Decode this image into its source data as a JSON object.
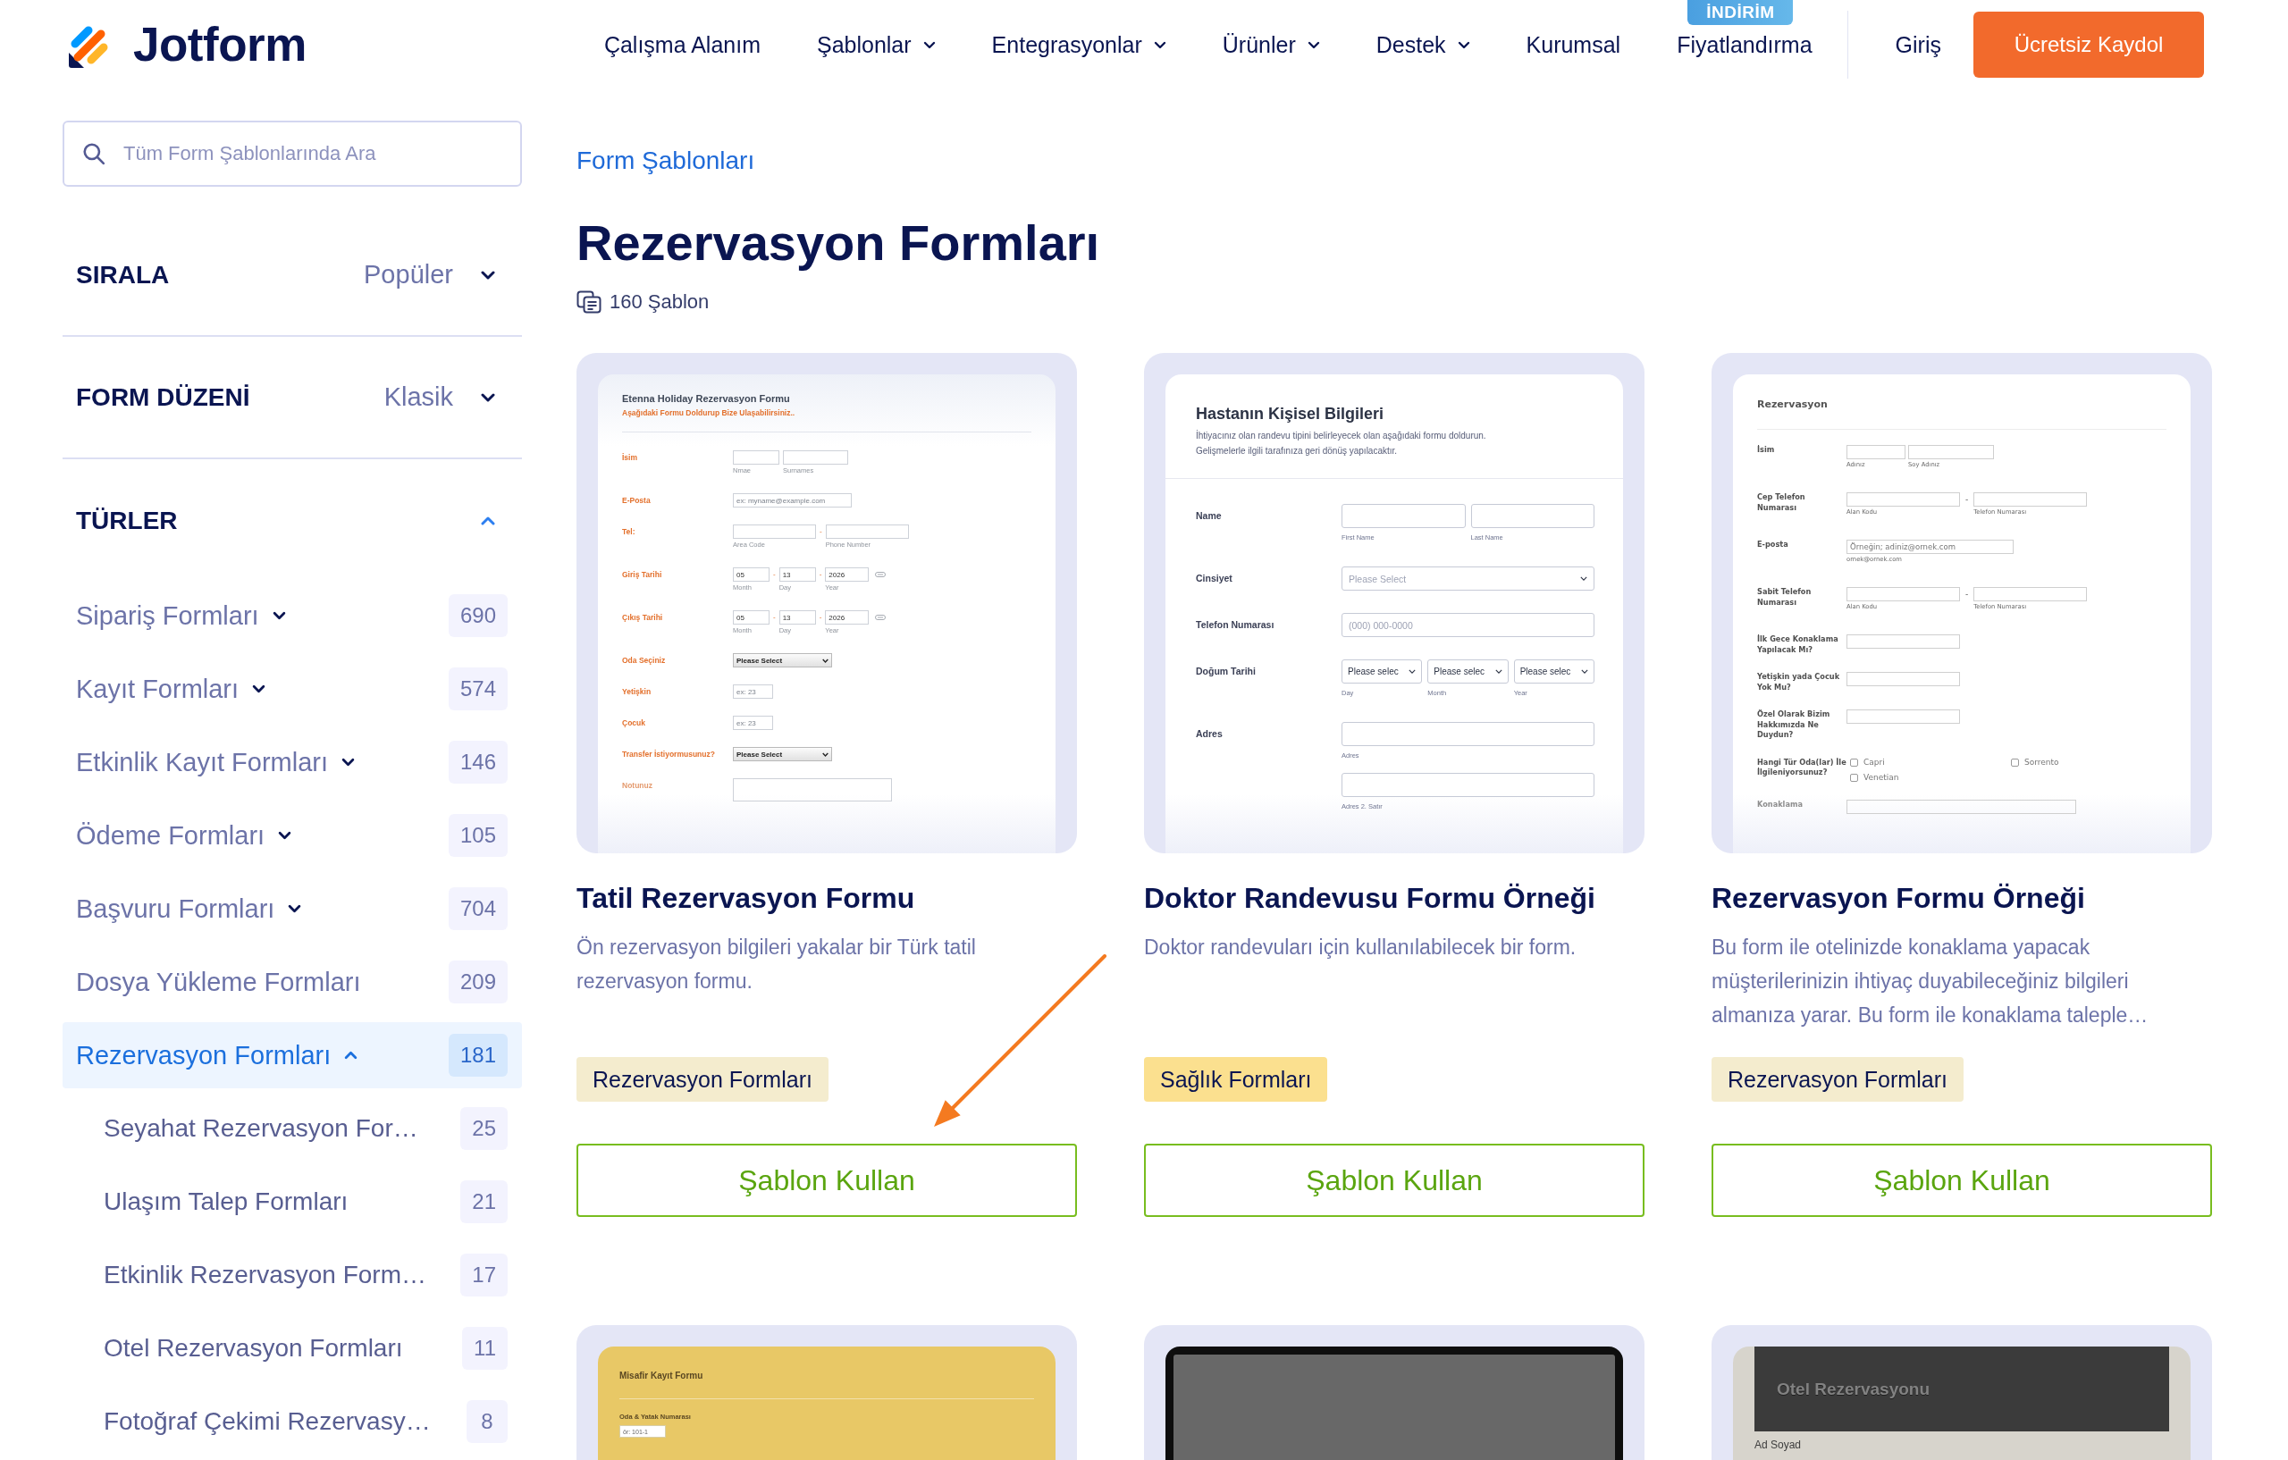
{
  "header": {
    "logo": "Jotform",
    "nav": [
      {
        "label": "Çalışma Alanım",
        "dropdown": false
      },
      {
        "label": "Şablonlar",
        "dropdown": true
      },
      {
        "label": "Entegrasyonlar",
        "dropdown": true
      },
      {
        "label": "Ürünler",
        "dropdown": true
      },
      {
        "label": "Destek",
        "dropdown": true
      },
      {
        "label": "Kurumsal",
        "dropdown": false
      },
      {
        "label": "Fiyatlandırma",
        "dropdown": false,
        "badge": "İNDİRİM"
      }
    ],
    "login": "Giriş",
    "signup": "Ücretsiz Kaydol"
  },
  "sidebar": {
    "search": {
      "placeholder": "Tüm Form Şablonlarında Ara"
    },
    "filters": [
      {
        "label": "SIRALA",
        "value": "Popüler"
      },
      {
        "label": "FORM DÜZENİ",
        "value": "Klasik"
      }
    ],
    "types": {
      "label": "TÜRLER",
      "expanded": true,
      "items": [
        {
          "label": "Sipariş Formları",
          "count": "690",
          "expandable": true,
          "expanded": false,
          "selected": false
        },
        {
          "label": "Kayıt Formları",
          "count": "574",
          "expandable": true,
          "expanded": false,
          "selected": false
        },
        {
          "label": "Etkinlik Kayıt Formları",
          "count": "146",
          "expandable": true,
          "expanded": false,
          "selected": false
        },
        {
          "label": "Ödeme Formları",
          "count": "105",
          "expandable": true,
          "expanded": false,
          "selected": false
        },
        {
          "label": "Başvuru Formları",
          "count": "704",
          "expandable": true,
          "expanded": false,
          "selected": false
        },
        {
          "label": "Dosya Yükleme Formları",
          "count": "209",
          "expandable": false,
          "expanded": false,
          "selected": false
        },
        {
          "label": "Rezervasyon Formları",
          "count": "181",
          "expandable": true,
          "expanded": true,
          "selected": true,
          "children": [
            {
              "label": "Seyahat Rezervasyon For…",
              "count": "25",
              "selected": false
            },
            {
              "label": "Ulaşım Talep Formları",
              "count": "21",
              "selected": false
            },
            {
              "label": "Etkinlik Rezervasyon Form…",
              "count": "17",
              "selected": false
            },
            {
              "label": "Otel Rezervasyon Formları",
              "count": "11",
              "selected": false
            },
            {
              "label": "Fotoğraf Çekimi Rezervasy…",
              "count": "8",
              "selected": false
            }
          ]
        }
      ]
    }
  },
  "main": {
    "breadcrumb": "Form Şablonları",
    "title": "Rezervasyon Formları",
    "count": "160 Şablon",
    "cards": [
      {
        "title": "Tatil Rezervasyon Formu",
        "description": "Ön rezervasyon bilgileri yakalar bir Türk tatil rezervasyon formu.",
        "tag": {
          "label": "Rezervasyon Formları",
          "color": "#f4ecce"
        },
        "button": "Şablon Kullan",
        "preview": {
          "kind": "classic",
          "title": "Etenna Holiday Rezervasyon Formu",
          "subtitle": "Aşağıdaki Formu Doldurup Bize Ulaşabilirsiniz..",
          "fields": [
            {
              "label": "İsim",
              "kind": "name",
              "inputs": [
                {
                  "sublabel": "Nmae"
                },
                {
                  "sublabel": "Surnames"
                }
              ]
            },
            {
              "label": "E-Posta",
              "kind": "email",
              "inputs": [
                {
                  "placeholder": "ex: myname@example.com"
                }
              ]
            },
            {
              "label": "Tel:",
              "kind": "phone",
              "joiner": "-",
              "inputs": [
                {
                  "sublabel": "Area Code"
                },
                {
                  "sublabel": "Phone Number"
                }
              ]
            },
            {
              "label": "Giriş Tarihi",
              "kind": "date",
              "joiner": "-",
              "calendar": true,
              "inputs": [
                {
                  "value": "05",
                  "sublabel": "Month"
                },
                {
                  "value": "13",
                  "sublabel": "Day"
                },
                {
                  "value": "2026",
                  "sublabel": "Year"
                }
              ]
            },
            {
              "label": "Çıkış Tarihi",
              "kind": "date",
              "joiner": "-",
              "calendar": true,
              "inputs": [
                {
                  "value": "05",
                  "sublabel": "Month"
                },
                {
                  "value": "13",
                  "sublabel": "Day"
                },
                {
                  "value": "2026",
                  "sublabel": "Year"
                }
              ]
            },
            {
              "label": "Oda Seçiniz",
              "kind": "select",
              "inputs": [
                {
                  "value": "Please Select"
                }
              ]
            },
            {
              "label": "Yetişkin",
              "kind": "number",
              "inputs": [
                {
                  "placeholder": "ex: 23"
                }
              ]
            },
            {
              "label": "Çocuk",
              "kind": "number",
              "inputs": [
                {
                  "placeholder": "ex: 23"
                }
              ]
            },
            {
              "label": "Transfer İstiyormusunuz?",
              "kind": "select",
              "inputs": [
                {
                  "value": "Please Select"
                }
              ]
            },
            {
              "label": "Notunuz",
              "kind": "textarea"
            }
          ]
        }
      },
      {
        "title": "Doktor Randevusu Formu Örneği",
        "description": "Doktor randevuları için kullanılabilecek bir form.",
        "tag": {
          "label": "Sağlık Formları",
          "color": "#fbe08f"
        },
        "button": "Şablon Kullan",
        "preview": {
          "kind": "modern",
          "title": "Hastanın Kişisel Bilgileri",
          "subtitle": "İhtiyacınız olan randevu tipini belirleyecek olan aşağıdaki formu doldurun. Gelişmelerle ilgili tarafınıza geri dönüş yapılacaktır.",
          "fields": [
            {
              "label": "Name",
              "kind": "name",
              "inputs": [
                {
                  "sublabel": "First Name"
                },
                {
                  "sublabel": "Last Name"
                }
              ]
            },
            {
              "label": "Cinsiyet",
              "kind": "select",
              "inputs": [
                {
                  "placeholder": "Please Select"
                }
              ]
            },
            {
              "label": "Telefon Numarası",
              "kind": "text",
              "inputs": [
                {
                  "placeholder": "(000) 000-0000"
                }
              ]
            },
            {
              "label": "Doğum Tarihi",
              "kind": "selects",
              "inputs": [
                {
                  "value": "Please selec",
                  "sublabel": "Day"
                },
                {
                  "value": "Please selec",
                  "sublabel": "Month"
                },
                {
                  "value": "Please selec",
                  "sublabel": "Year"
                }
              ]
            },
            {
              "label": "Adres",
              "kind": "address",
              "inputs": [
                {
                  "sublabel": "Adres"
                },
                {
                  "sublabel": "Adres 2. Satır"
                }
              ]
            }
          ]
        }
      },
      {
        "title": "Rezervasyon Formu Örneği",
        "description": "Bu form ile otelinizde konaklama yapacak müşterilerinizin ihtiyaç duyabileceğiniz bilgileri almanıza yarar. Bu form ile konaklama taleple…",
        "tag": {
          "label": "Rezervasyon Formları",
          "color": "#f4ecce"
        },
        "button": "Şablon Kullan",
        "preview": {
          "kind": "compact",
          "title": "Rezervasyon",
          "fields": [
            {
              "label": "İsim",
              "kind": "name",
              "inputs": [
                {
                  "sublabel": "Adınız"
                },
                {
                  "sublabel": "Soy Adınız"
                }
              ]
            },
            {
              "label": "Cep Telefon Numarası",
              "kind": "phone",
              "joiner": "-",
              "inputs": [
                {
                  "sublabel": "Alan Kodu"
                },
                {
                  "sublabel": "Telefon Numarası"
                }
              ]
            },
            {
              "label": "E-posta",
              "kind": "email",
              "inputs": [
                {
                  "placeholder": "Örneğin; adiniz@ornek.com",
                  "sublabel": "ornek@ornek.com"
                }
              ]
            },
            {
              "label": "Sabit Telefon Numarası",
              "kind": "phone",
              "joiner": "-",
              "inputs": [
                {
                  "sublabel": "Alan Kodu"
                },
                {
                  "sublabel": "Telefon Numarası"
                }
              ]
            },
            {
              "label": "İlk Gece Konaklama Yapılacak Mı?",
              "kind": "text"
            },
            {
              "label": "Yetişkin yada Çocuk Yok Mu?",
              "kind": "text"
            },
            {
              "label": "Özel Olarak Bizim Hakkımızda Ne Duydun?",
              "kind": "text"
            },
            {
              "label": "Hangi Tür Oda(lar) İle İlgileniyorsunuz?",
              "kind": "checks",
              "options": [
                {
                  "label": "Capri",
                  "checked": false
                },
                {
                  "label": "Sorrento",
                  "checked": false
                },
                {
                  "label": "Venetian",
                  "checked": false
                }
              ]
            },
            {
              "label": "Konaklama",
              "kind": "wide"
            }
          ]
        }
      },
      {
        "preview": {
          "kind": "stacked",
          "title": "Misafir Kayıt Formu",
          "fields": [
            {
              "label": "Oda & Yatak Numarası",
              "kind": "text",
              "inputs": [
                {
                  "placeholder": "ör: 101-1"
                }
              ]
            }
          ]
        }
      },
      {
        "preview": {
          "kind": "screen"
        }
      },
      {
        "preview": {
          "kind": "banner",
          "title": "Otel Rezervasyonu",
          "fields": [
            {
              "label": "Ad Soyad",
              "kind": "label"
            }
          ]
        }
      }
    ]
  }
}
